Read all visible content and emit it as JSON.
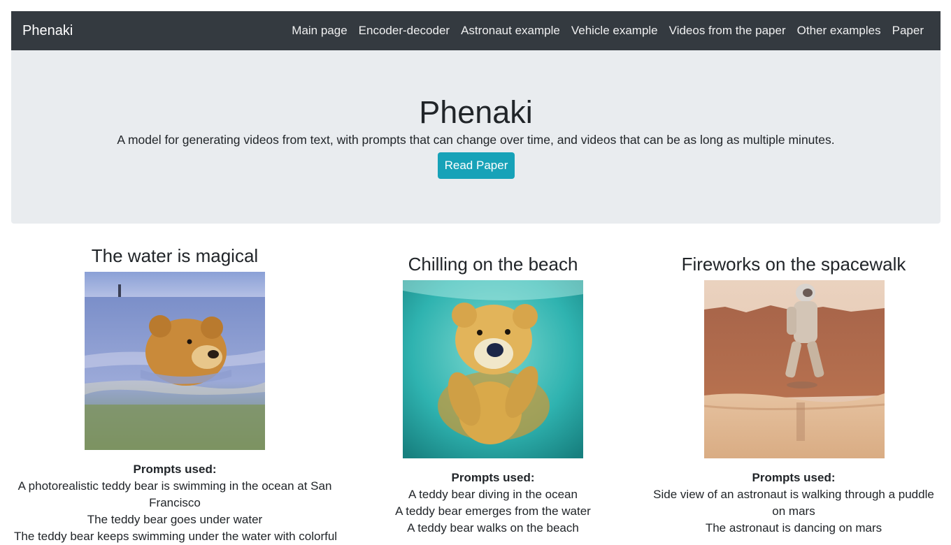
{
  "navbar": {
    "brand": "Phenaki",
    "links": [
      "Main page",
      "Encoder-decoder",
      "Astronaut example",
      "Vehicle example",
      "Videos from the paper",
      "Other examples",
      "Paper"
    ]
  },
  "hero": {
    "title": "Phenaki",
    "subtitle": "A model for generating videos from text, with prompts that can change over time, and videos that can be as long as multiple minutes.",
    "button_label": "Read Paper"
  },
  "examples": [
    {
      "title": "The water is magical",
      "image": "teddy-bear-swimming-in-ocean",
      "prompts_label": "Prompts used:",
      "prompts": [
        "A photorealistic teddy bear is swimming in the ocean at San Francisco",
        "The teddy bear goes under water",
        "The teddy bear keeps swimming under the water with colorful"
      ]
    },
    {
      "title": "Chilling on the beach",
      "image": "teddy-bear-diving-underwater",
      "prompts_label": "Prompts used:",
      "prompts": [
        "A teddy bear diving in the ocean",
        "A teddy bear emerges from the water",
        "A teddy bear walks on the beach"
      ]
    },
    {
      "title": "Fireworks on the spacewalk",
      "image": "astronaut-walking-on-mars",
      "prompts_label": "Prompts used:",
      "prompts": [
        "Side view of an astronaut is walking through a puddle on mars",
        "The astronaut is dancing on mars"
      ]
    }
  ]
}
